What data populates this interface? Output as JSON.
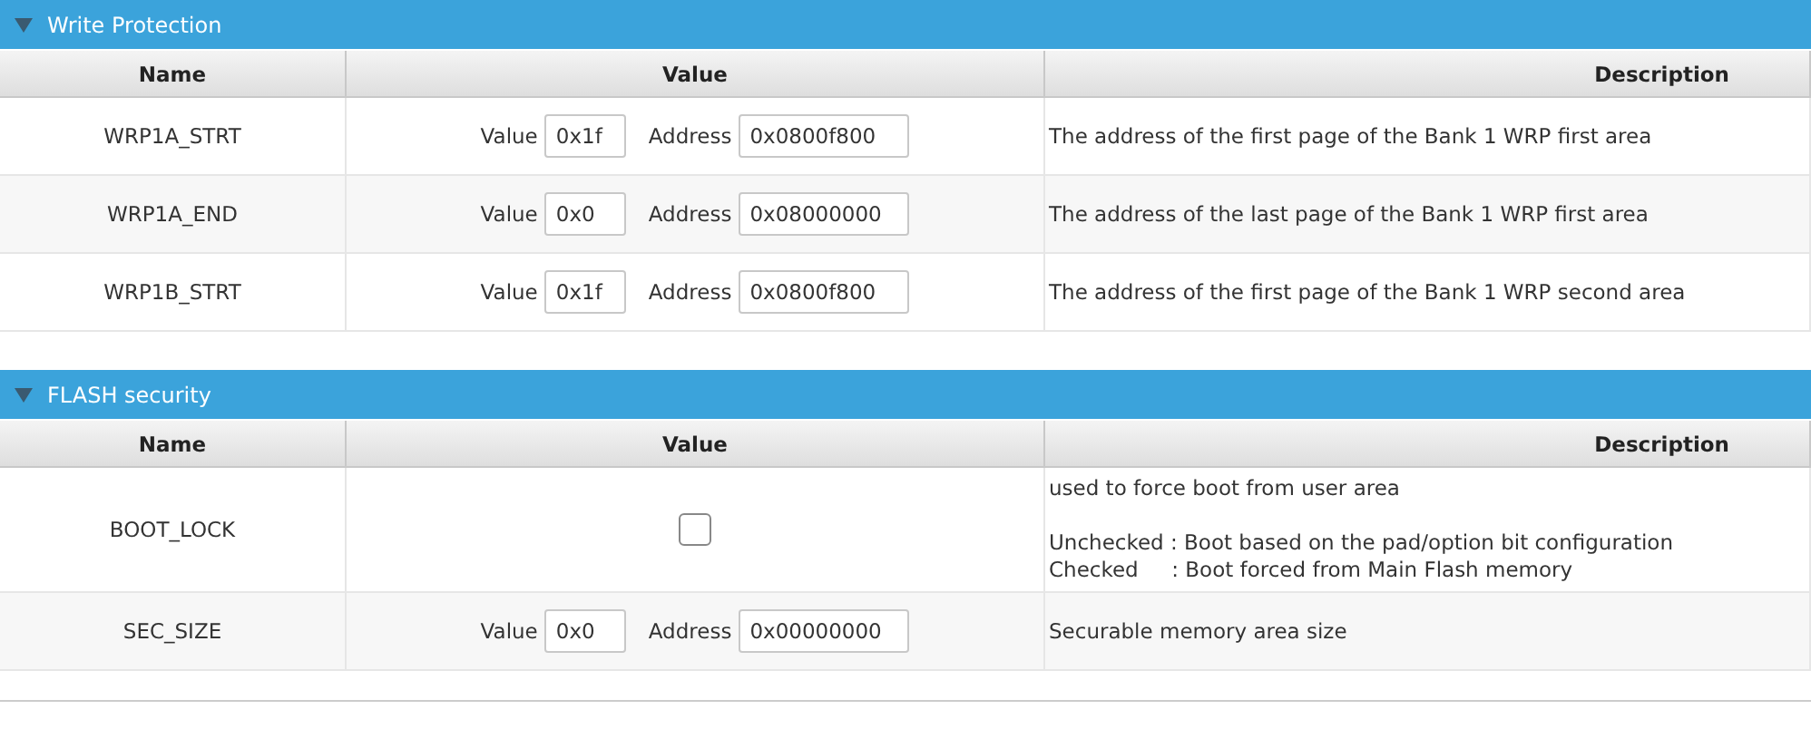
{
  "sections": [
    {
      "title": "Write Protection",
      "expanded": true,
      "columns": [
        "Name",
        "Value",
        "Description"
      ],
      "rows": [
        {
          "kind": "value_address",
          "name": "WRP1A_STRT",
          "value_label": "Value",
          "value": "0x1f",
          "address_label": "Address",
          "address": "0x0800f800",
          "description": "The address of the first page of the Bank 1 WRP first area"
        },
        {
          "kind": "value_address",
          "name": "WRP1A_END",
          "value_label": "Value",
          "value": "0x0",
          "address_label": "Address",
          "address": "0x08000000",
          "description": "The address of the last page of the Bank 1 WRP first area"
        },
        {
          "kind": "value_address",
          "name": "WRP1B_STRT",
          "value_label": "Value",
          "value": "0x1f",
          "address_label": "Address",
          "address": "0x0800f800",
          "description": "The address of the first page of the Bank 1 WRP second area"
        }
      ]
    },
    {
      "title": "FLASH security",
      "expanded": true,
      "columns": [
        "Name",
        "Value",
        "Description"
      ],
      "rows": [
        {
          "kind": "checkbox",
          "name": "BOOT_LOCK",
          "checked": false,
          "description": "used to force boot from user area\n\nUnchecked : Boot based on the pad/option bit configuration\nChecked     : Boot forced from Main Flash memory"
        },
        {
          "kind": "value_address",
          "name": "SEC_SIZE",
          "value_label": "Value",
          "value": "0x0",
          "address_label": "Address",
          "address": "0x00000000",
          "description": "Securable memory area size"
        }
      ]
    }
  ]
}
